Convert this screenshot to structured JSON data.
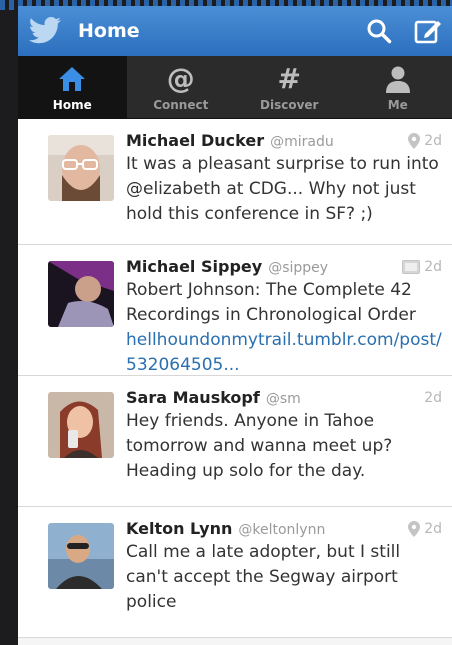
{
  "actionbar": {
    "title": "Home"
  },
  "tabs": [
    {
      "label": "Home",
      "icon": "home-icon",
      "active": true
    },
    {
      "label": "Connect",
      "icon": "at-icon",
      "active": false
    },
    {
      "label": "Discover",
      "icon": "hash-icon",
      "active": false
    },
    {
      "label": "Me",
      "icon": "user-icon",
      "active": false
    }
  ],
  "tweets": [
    {
      "name": "Michael Ducker",
      "handle": "@miradu",
      "time": "2d",
      "meta_icon": "location-pin-icon",
      "text": "It was a pleasant surprise to run into @elizabeth at CDG... Why not just hold this conference in SF? ;)"
    },
    {
      "name": "Michael Sippey",
      "handle": "@sippey",
      "time": "2d",
      "meta_icon": "image-icon",
      "text": "Robert Johnson: The Complete 42 Recordings in Chronological Order",
      "link": "hellhoundonmytrail.tumblr.com/post/532064505..."
    },
    {
      "name": "Sara Mauskopf",
      "handle": "@sm",
      "time": "2d",
      "meta_icon": "",
      "text": "Hey friends. Anyone in Tahoe tomorrow and wanna meet up? Heading up solo for the day."
    },
    {
      "name": "Kelton Lynn",
      "handle": "@keltonlynn",
      "time": "2d",
      "meta_icon": "location-pin-icon",
      "text": "Call me a late adopter, but I still can't accept the Segway airport police"
    }
  ]
}
